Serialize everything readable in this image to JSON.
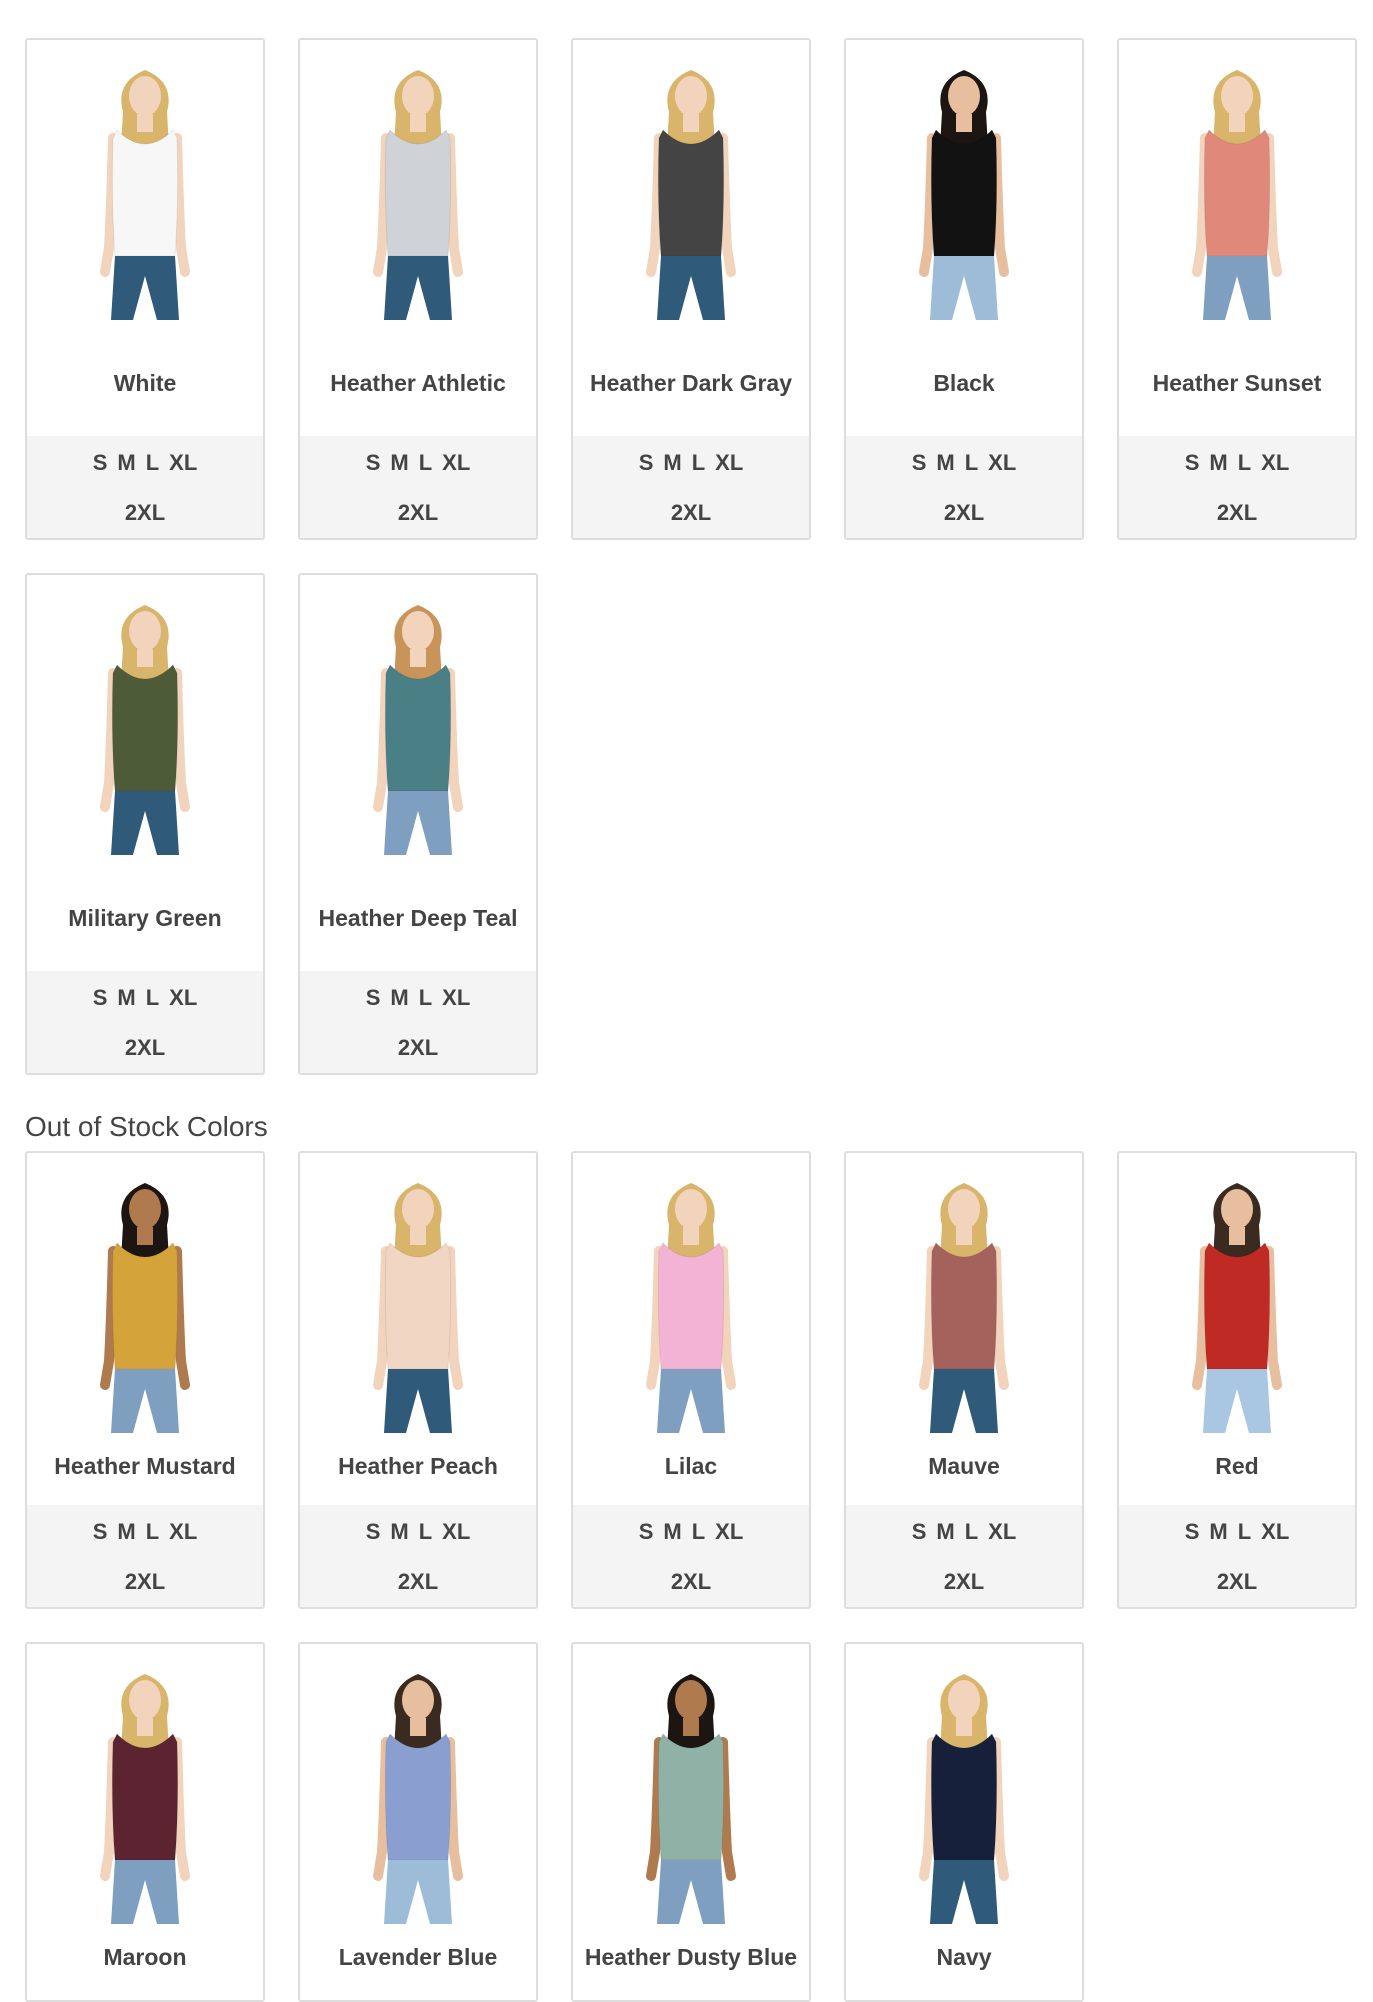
{
  "in_stock": [
    {
      "name": "White",
      "sizes": [
        "S",
        "M",
        "L",
        "XL"
      ],
      "sizes_row2": "2XL",
      "shirt": "#f7f7f7",
      "hair": "#d9b56b",
      "skin": "#f2d3bc",
      "pants": "#2f5a7a"
    },
    {
      "name": "Heather Athletic",
      "sizes": [
        "S",
        "M",
        "L",
        "XL"
      ],
      "sizes_row2": "2XL",
      "shirt": "#cfd2d6",
      "hair": "#d9b56b",
      "skin": "#f2d3bc",
      "pants": "#2f5a7a"
    },
    {
      "name": "Heather Dark Gray",
      "sizes": [
        "S",
        "M",
        "L",
        "XL"
      ],
      "sizes_row2": "2XL",
      "shirt": "#454445",
      "hair": "#d9b56b",
      "skin": "#f2d3bc",
      "pants": "#2f5a7a"
    },
    {
      "name": "Black",
      "sizes": [
        "S",
        "M",
        "L",
        "XL"
      ],
      "sizes_row2": "2XL",
      "shirt": "#121212",
      "hair": "#1c1512",
      "skin": "#e7bf9f",
      "pants": "#9cbcd8"
    },
    {
      "name": "Heather Sunset",
      "sizes": [
        "S",
        "M",
        "L",
        "XL"
      ],
      "sizes_row2": "2XL",
      "shirt": "#e0887a",
      "hair": "#d9b56b",
      "skin": "#f2d3bc",
      "pants": "#7f9fc0"
    },
    {
      "name": "Military Green",
      "sizes": [
        "S",
        "M",
        "L",
        "XL"
      ],
      "sizes_row2": "2XL",
      "shirt": "#4e5b38",
      "hair": "#d9b56b",
      "skin": "#f2d3bc",
      "pants": "#2f5a7a"
    },
    {
      "name": "Heather Deep Teal",
      "sizes": [
        "S",
        "M",
        "L",
        "XL"
      ],
      "sizes_row2": "2XL",
      "shirt": "#4a7f85",
      "hair": "#c9945a",
      "skin": "#f2d3bc",
      "pants": "#7f9fc0"
    }
  ],
  "out_of_stock_heading": "Out of Stock Colors",
  "out_of_stock": [
    {
      "name": "Heather Mustard",
      "sizes": [
        "S",
        "M",
        "L",
        "XL"
      ],
      "sizes_row2": "2XL",
      "shirt": "#d4a33a",
      "hair": "#1c1512",
      "skin": "#b07a4f",
      "pants": "#7f9fc0"
    },
    {
      "name": "Heather Peach",
      "sizes": [
        "S",
        "M",
        "L",
        "XL"
      ],
      "sizes_row2": "2XL",
      "shirt": "#f1d6c4",
      "hair": "#d9b56b",
      "skin": "#f2d3bc",
      "pants": "#2f5a7a"
    },
    {
      "name": "Lilac",
      "sizes": [
        "S",
        "M",
        "L",
        "XL"
      ],
      "sizes_row2": "2XL",
      "shirt": "#f3b3d4",
      "hair": "#d9b56b",
      "skin": "#f2d3bc",
      "pants": "#7f9fc0"
    },
    {
      "name": "Mauve",
      "sizes": [
        "S",
        "M",
        "L",
        "XL"
      ],
      "sizes_row2": "2XL",
      "shirt": "#a5625c",
      "hair": "#d9b56b",
      "skin": "#f2d3bc",
      "pants": "#2f5a7a"
    },
    {
      "name": "Red",
      "sizes": [
        "S",
        "M",
        "L",
        "XL"
      ],
      "sizes_row2": "2XL",
      "shirt": "#c02a24",
      "hair": "#3a2a20",
      "skin": "#e7bf9f",
      "pants": "#a9c6e2"
    },
    {
      "name": "Maroon",
      "sizes": [],
      "sizes_row2": "",
      "shirt": "#5c2430",
      "hair": "#d9b56b",
      "skin": "#f2d3bc",
      "pants": "#7f9fc0"
    },
    {
      "name": "Lavender Blue",
      "sizes": [],
      "sizes_row2": "",
      "shirt": "#8a9fd0",
      "hair": "#3a2a20",
      "skin": "#e7bf9f",
      "pants": "#9cbcd8"
    },
    {
      "name": "Heather Dusty Blue",
      "sizes": [],
      "sizes_row2": "",
      "shirt": "#8fb1a6",
      "hair": "#1c1512",
      "skin": "#b07a4f",
      "pants": "#7f9fc0"
    },
    {
      "name": "Navy",
      "sizes": [],
      "sizes_row2": "",
      "shirt": "#17203a",
      "hair": "#d9b56b",
      "skin": "#f2d3bc",
      "pants": "#2f5a7a"
    }
  ]
}
